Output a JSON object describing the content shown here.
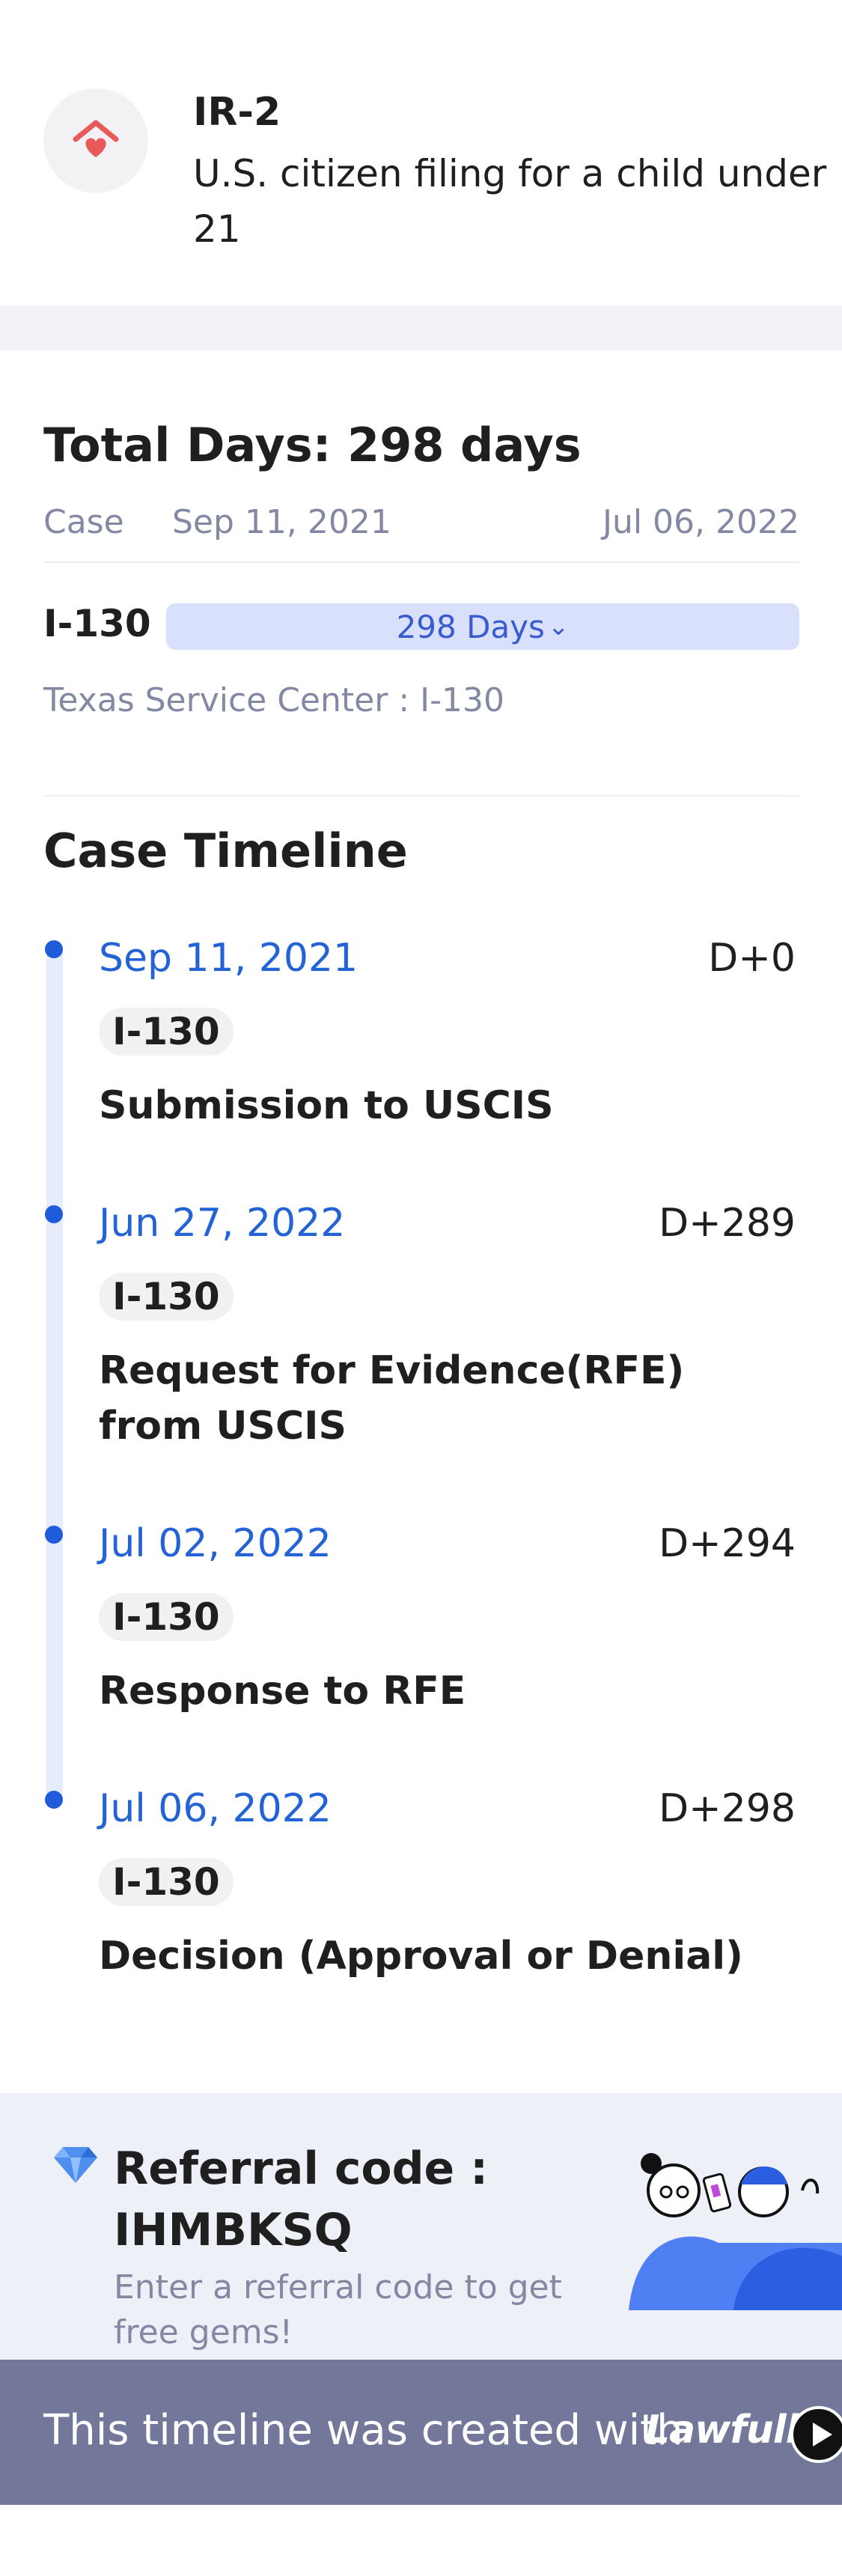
{
  "visa": {
    "code": "IR-2",
    "description": "U.S. citizen filing for a child under 21",
    "icon": "house-heart-icon"
  },
  "summary": {
    "total_days": "Total Days: 298 days",
    "case_label": "Case",
    "start_date": "Sep 11, 2021",
    "end_date": "Jul 06, 2022",
    "form_name": "I-130",
    "bar_label": "298 Days",
    "bar_fill_fraction": 1.0,
    "service_center": "Texas Service Center : I-130"
  },
  "timeline": {
    "title": "Case Timeline",
    "items": [
      {
        "date": "Sep 11, 2021",
        "day": "D+0",
        "tag": "I-130",
        "desc": "Submission to USCIS"
      },
      {
        "date": "Jun 27, 2022",
        "day": "D+289",
        "tag": "I-130",
        "desc": "Request for Evidence(RFE) from USCIS"
      },
      {
        "date": "Jul 02, 2022",
        "day": "D+294",
        "tag": "I-130",
        "desc": "Response to RFE"
      },
      {
        "date": "Jul 06, 2022",
        "day": "D+298",
        "tag": "I-130",
        "desc": "Decision (Approval or Denial)"
      }
    ]
  },
  "referral": {
    "title": "Referral code : IHMBKSQ",
    "subtitle": "Enter a referral code to get free gems!",
    "icon": "gem-icon"
  },
  "footer": {
    "text": "This timeline was created with",
    "brand": "Lawfully",
    "icon": "play-icon"
  },
  "colors": {
    "accent_blue": "#2463d6",
    "bar_fill": "#d8e0fb",
    "muted_text": "#8489a3",
    "footer_bg": "#73789a",
    "icon_red": "#e85a5a"
  }
}
